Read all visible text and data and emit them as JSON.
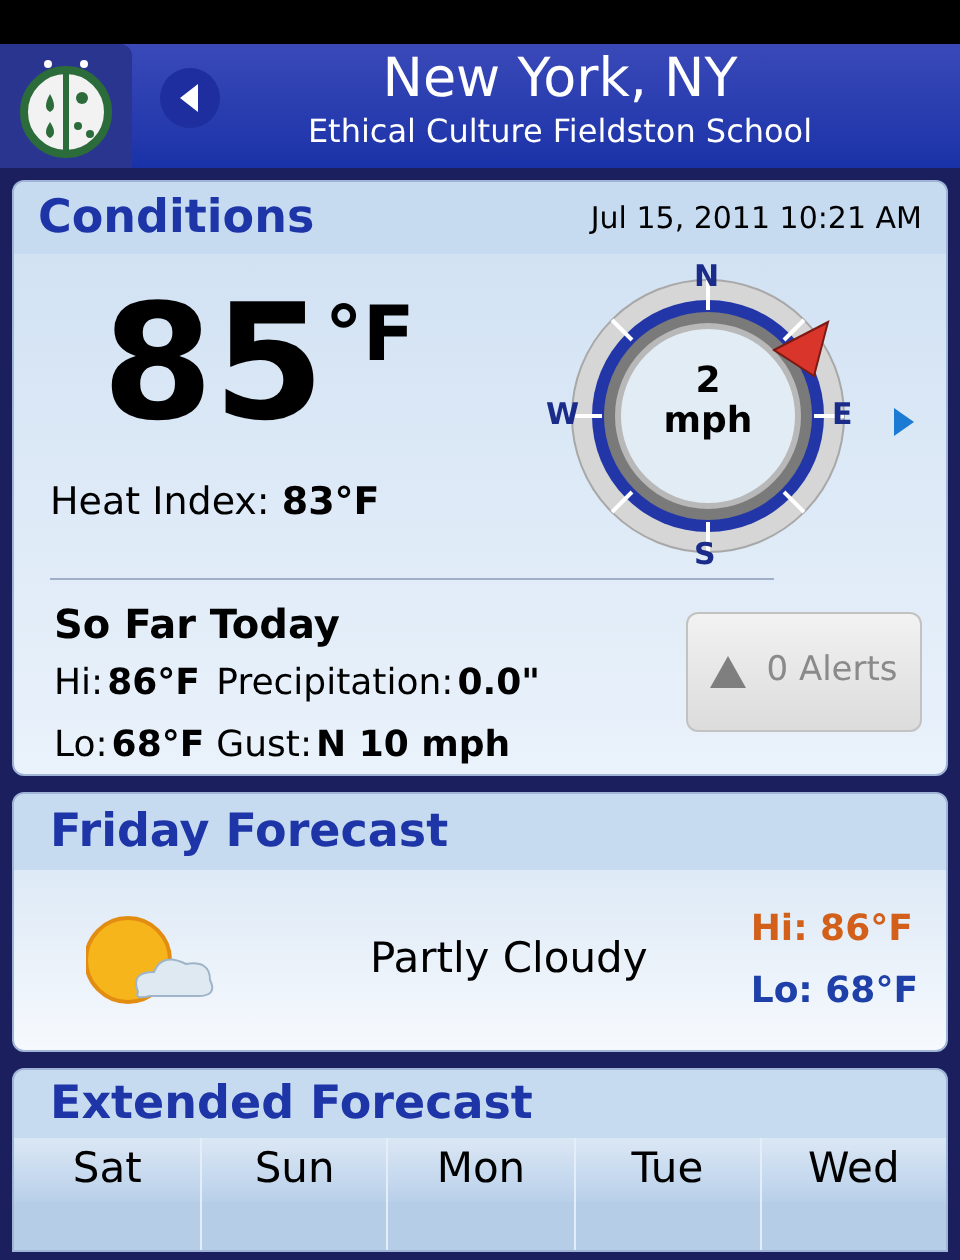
{
  "header": {
    "city": "New York, NY",
    "station": "Ethical Culture Fieldston School"
  },
  "conditions": {
    "title": "Conditions",
    "timestamp": "Jul 15, 2011 10:21 AM",
    "temperature": "85",
    "unit": "°F",
    "heat_index": "Heat Index: **83°F**",
    "wind": {
      "speed": "2",
      "unit": "mph",
      "labels": [
        "N",
        "E",
        "S",
        "W"
      ]
    },
    "so_far_today": {
      "title": "So Far Today",
      "items": [
        {
          "label": "Hi:",
          "value": "86°F"
        },
        {
          "label": "Precipitation:",
          "value": "0.0\""
        },
        {
          "label": "Lo:",
          "value": "68°F"
        },
        {
          "label": "Gust:",
          "value": "N 10 mph"
        }
      ]
    },
    "alerts_button": "0 Alerts"
  },
  "friday_forecast": {
    "title": "Friday Forecast",
    "summary": "Partly Cloudy",
    "hi": "Hi: 86°F",
    "lo": "Lo: 68°F"
  },
  "extended_forecast": {
    "title": "Extended Forecast",
    "days": [
      "Sat",
      "Sun",
      "Mon",
      "Tue",
      "Wed"
    ]
  }
}
